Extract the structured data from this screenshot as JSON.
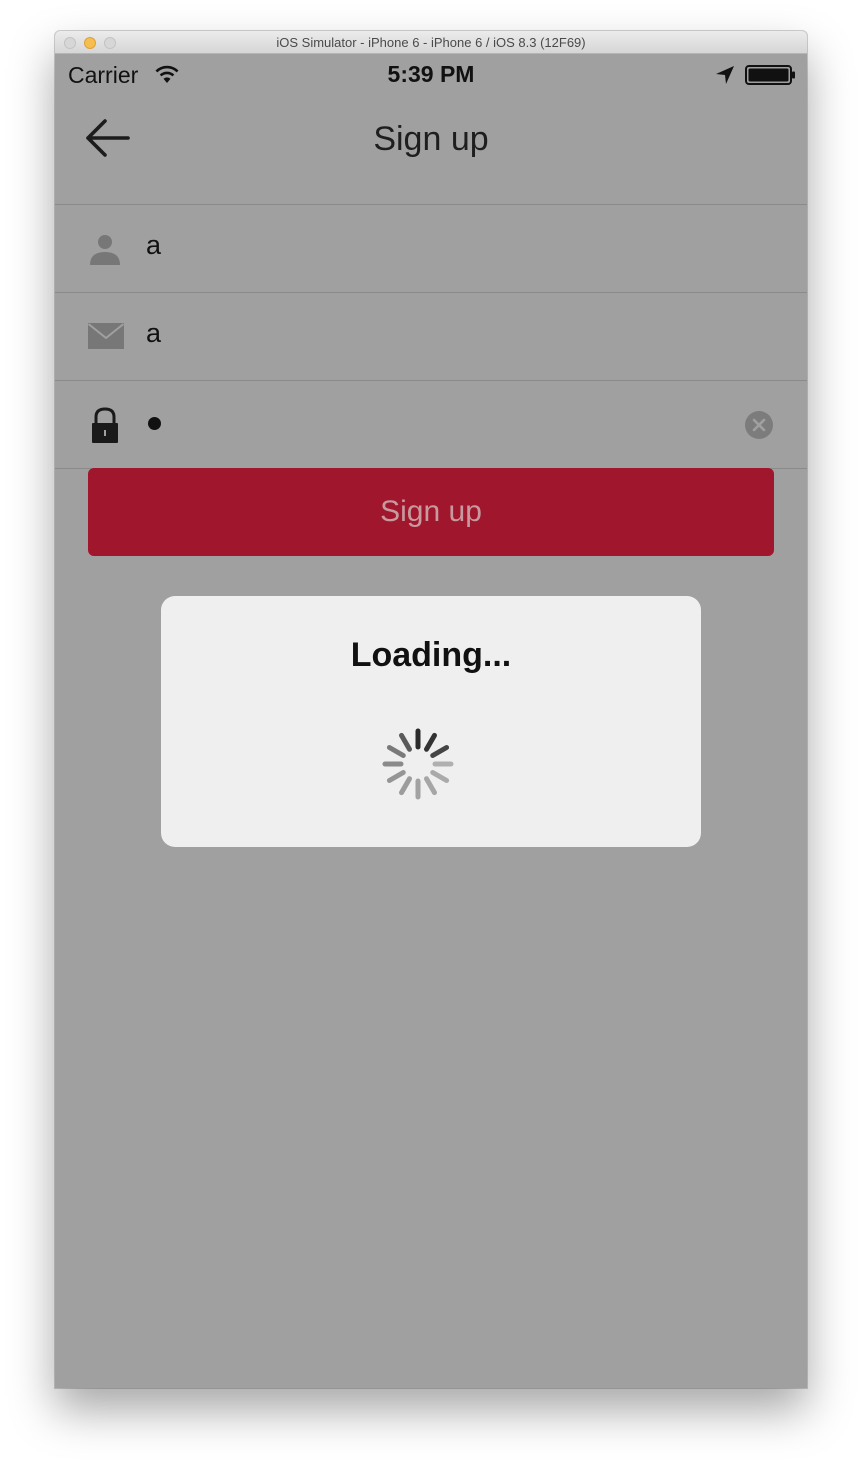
{
  "window": {
    "title": "iOS Simulator - iPhone 6 - iPhone 6 / iOS 8.3 (12F69)"
  },
  "status_bar": {
    "carrier": "Carrier",
    "time": "5:39 PM"
  },
  "nav": {
    "title": "Sign up",
    "back_icon": "arrow-left-icon"
  },
  "form": {
    "fields": [
      {
        "icon": "person-icon",
        "value": "a"
      },
      {
        "icon": "envelope-icon",
        "value": "a"
      },
      {
        "icon": "lock-icon",
        "value": "•",
        "secure": true
      }
    ]
  },
  "button": {
    "label": "Sign up",
    "color": "#a0162c"
  },
  "hud": {
    "title": "Loading..."
  },
  "colors": {
    "screen_bg": "#a0a0a0",
    "hud_bg": "#efefef"
  }
}
